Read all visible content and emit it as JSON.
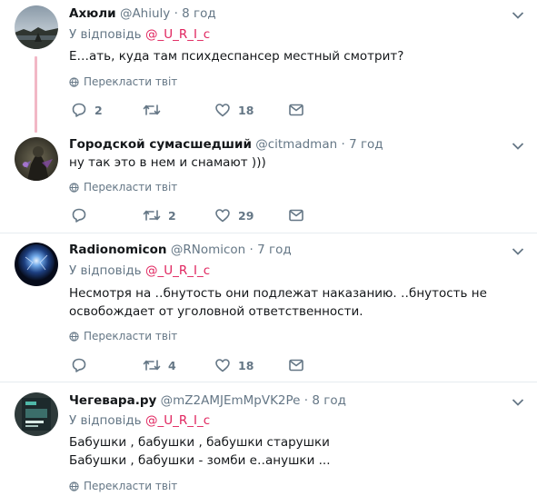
{
  "tweets": [
    {
      "name": "Ахюли",
      "handle": "@Ahiuly",
      "dot": "·",
      "time": "8 год",
      "reply_label": "У відповідь",
      "reply_mention": "@_U_R_I_c",
      "text": "Е…ать, куда там психдеспансер местный смотрит?",
      "translate": "Перекласти твіт",
      "replies": "2",
      "retweets": "",
      "likes": "18"
    },
    {
      "name": "Городской сумасшедший",
      "handle": "@citmadman",
      "dot": "·",
      "time": "7 год",
      "text": "ну так это в нем и снамают )))",
      "translate": "Перекласти твіт",
      "replies": "",
      "retweets": "2",
      "likes": "29"
    },
    {
      "name": "Radionomicon",
      "handle": "@RNomicon",
      "dot": "·",
      "time": "7 год",
      "reply_label": "У відповідь",
      "reply_mention": "@_U_R_I_c",
      "text_line1": "Несмотря на ‥бнутость они подлежат наказанию. ‥бнутость не",
      "text_line2": "освобождает от уголовной ответственности.",
      "translate": "Перекласти твіт",
      "replies": "",
      "retweets": "4",
      "likes": "18"
    },
    {
      "name": "Чегевара.ру",
      "handle": "@mZ2AMJEmMpVK2Pe",
      "dot": "·",
      "time": "8 год",
      "reply_label": "У відповідь",
      "reply_mention": "@_U_R_I_c",
      "text_line1": "Бабушки , бабушки , бабушки старушки",
      "text_line2": "Бабушки , бабушки - зомби е‥анушки ...",
      "translate": "Перекласти твіт"
    }
  ],
  "colors": {
    "name": "#14171a",
    "secondary": "#657786",
    "mention": "#e0245e",
    "thread_line": "#f2b8c6",
    "divider": "#e6ecf0"
  }
}
